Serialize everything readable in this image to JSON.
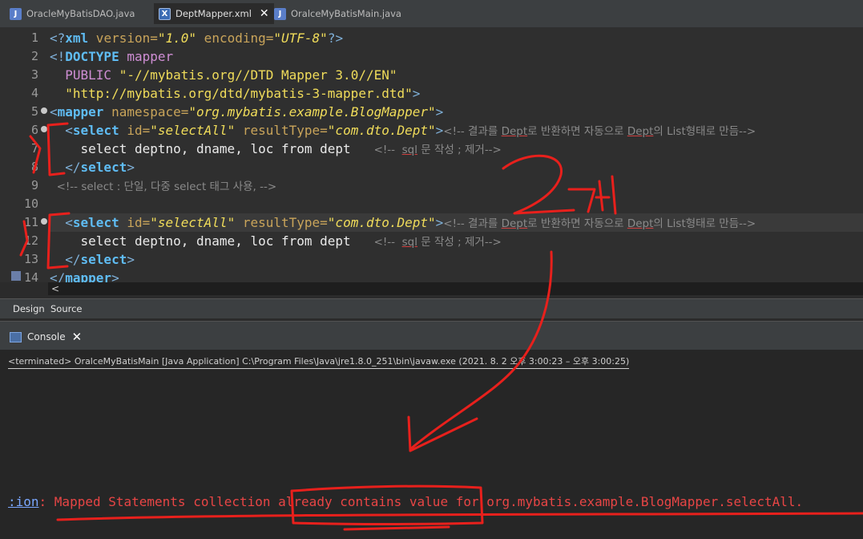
{
  "tabs": [
    {
      "label": "OracleMyBatisDAO.java",
      "icon": "java-file-icon"
    },
    {
      "label": "DeptMapper.xml",
      "icon": "xml-file-icon",
      "active": true,
      "close": "✕"
    },
    {
      "label": "OralceMyBatisMain.java",
      "icon": "java-file-icon"
    }
  ],
  "editor": {
    "line_numbers": [
      "1",
      "2",
      "3",
      "4",
      "5",
      "6",
      "7",
      "8",
      "9",
      "10",
      "11",
      "12",
      "13",
      "14"
    ]
  },
  "code": {
    "l1": {
      "a": "<?",
      "b": "xml",
      "c": " version=",
      "d": "\"1.0\"",
      "e": " encoding=",
      "f": "\"UTF-8\"",
      "g": "?>"
    },
    "l2": {
      "a": "<!",
      "b": "DOCTYPE",
      "c": " mapper"
    },
    "l3": {
      "a": "  PUBLIC ",
      "b": "\"-//mybatis.org//DTD Mapper 3.0//EN\""
    },
    "l4": {
      "a": "  ",
      "b": "\"http://mybatis.org/dtd/mybatis-3-mapper.dtd\"",
      "c": ">"
    },
    "l5": {
      "a": "<",
      "b": "mapper",
      "c": " namespace=",
      "d": "\"org.mybatis.example.BlogMapper\"",
      "e": ">"
    },
    "l6": {
      "a": "  <",
      "b": "select",
      "c": " id=",
      "d": "\"selectAll\"",
      "e": " resultType=",
      "f": "\"com.dto.Dept\"",
      "g": ">",
      "h": "<!-- 결과를 ",
      "i": "Dept",
      "j": "로 반환하면 자동으로 ",
      "k": "Dept",
      "l": "의 List형태로 만듬-->"
    },
    "l7": {
      "a": "    select deptno, dname, loc from dept   ",
      "b": "<!--  ",
      "c": "sql",
      "d": " 문 작성 ; 제거-->"
    },
    "l8": {
      "a": "  </",
      "b": "select",
      "c": ">"
    },
    "l9": {
      "a": "  <!-- select : 단일, 다중 select 태그 사용, -->"
    },
    "l10": {
      "a": ""
    },
    "l11": {
      "a": "  <",
      "b": "select",
      "c": " id=",
      "d": "\"selectAll\"",
      "e": " resultType=",
      "f": "\"com.dto.Dept\"",
      "g": ">",
      "h": "<!-- 결과를 ",
      "i": "Dept",
      "j": "로 반환하면 자동으로 ",
      "k": "Dept",
      "l": "의 List형태로 만듬-->"
    },
    "l12": {
      "a": "    select deptno, dname, loc from dept   ",
      "b": "<!--  ",
      "c": "sql",
      "d": " 문 작성 ; 제거-->"
    },
    "l13": {
      "a": "  </",
      "b": "select",
      "c": ">"
    },
    "l14": {
      "a": "</",
      "b": "mapper",
      "c": ">"
    }
  },
  "hscroll_arrow": "<",
  "bottom_tabs": [
    "Design",
    "Source"
  ],
  "console": {
    "tab_label": "Console",
    "close": "✕",
    "terminated": "<terminated> OralceMyBatisMain [Java Application] C:\\Program Files\\Java\\jre1.8.0_251\\bin\\javaw.exe  (2021. 8. 2 오후 3:00:23 – 오후 3:00:25)",
    "error_prefix": ":ion",
    "error_text": ": Mapped Statements collection already contains value for org.mybatis.example.BlogMapper.selectAll."
  },
  "annotation": {
    "text": "2개",
    "color": "#e8201c"
  }
}
